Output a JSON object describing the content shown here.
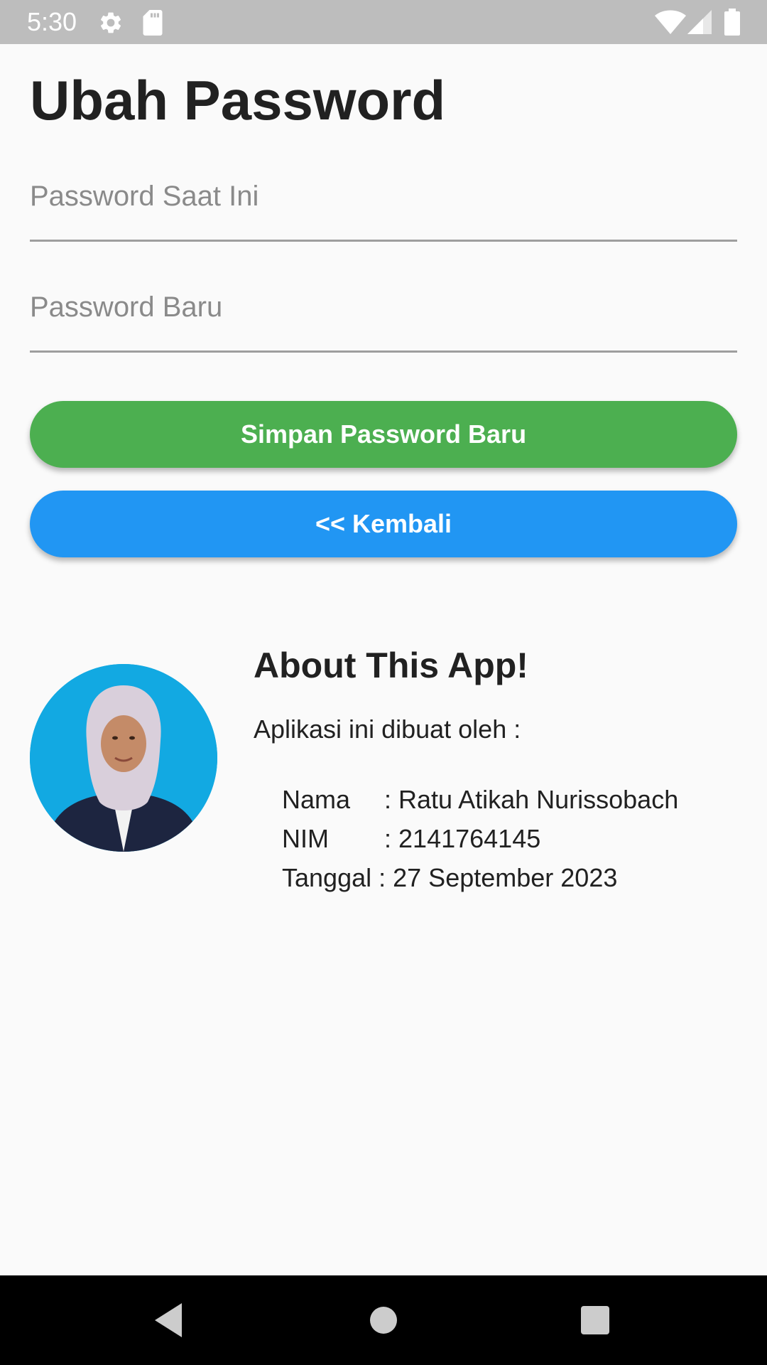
{
  "status_bar": {
    "time": "5:30",
    "icons": [
      "gear-icon",
      "sd-card-icon",
      "wifi-icon",
      "signal-icon",
      "battery-icon"
    ]
  },
  "page": {
    "title": "Ubah Password"
  },
  "form": {
    "current_password_placeholder": "Password Saat Ini",
    "current_password_value": "",
    "new_password_placeholder": "Password Baru",
    "new_password_value": "",
    "save_label": "Simpan Password Baru",
    "back_label": "<< Kembali"
  },
  "about": {
    "title": "About This App!",
    "intro": "Aplikasi ini dibuat oleh :",
    "nama_label": "Nama",
    "nama_value": ": Ratu Atikah Nurissobach",
    "nim_label": "NIM",
    "nim_value": ": 2141764145",
    "tanggal_label": "Tanggal",
    "tanggal_value": " : 27 September 2023"
  },
  "nav": {
    "icons": [
      "back-icon",
      "home-icon",
      "recents-icon"
    ]
  },
  "colors": {
    "status_bar": "#bdbdbd",
    "save_button": "#4caf50",
    "back_button": "#2196f3",
    "avatar_background": "#12a9e2",
    "nav_bar": "#000000"
  }
}
